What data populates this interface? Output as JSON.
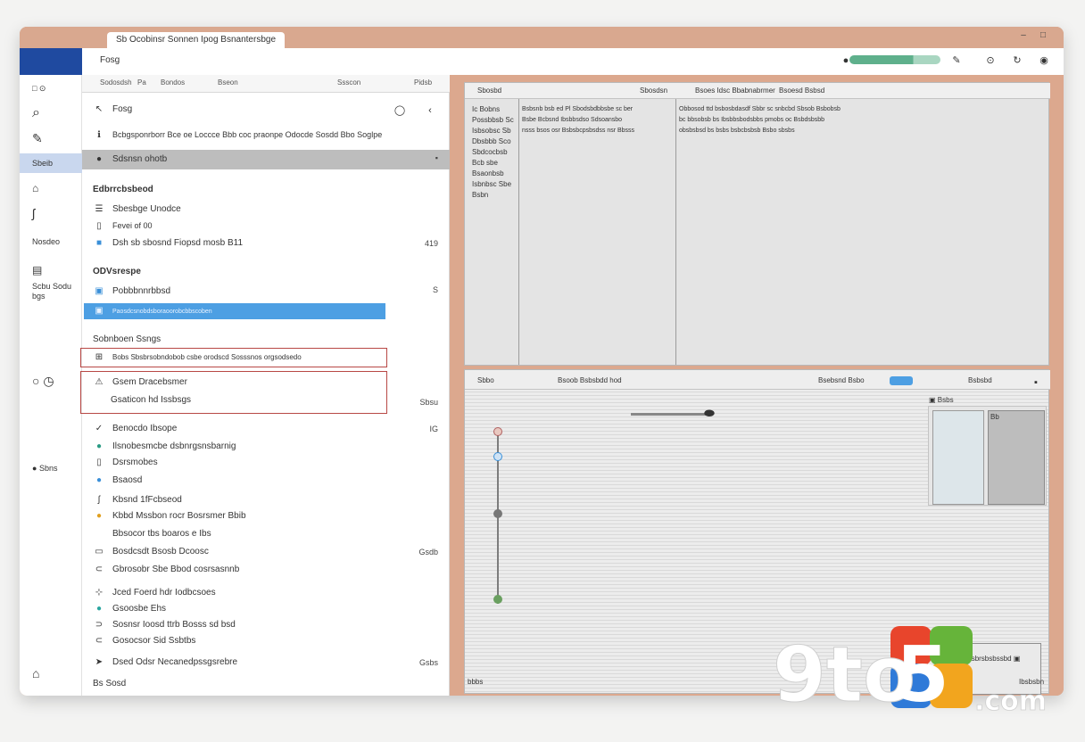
{
  "window": {
    "tab_title": "Sb Ocobinsr Sonnen Ipog Bsnantersbge",
    "tab_icon": "Bq"
  },
  "topbar": {
    "label": "Fosg",
    "progress": 0.7
  },
  "rail": {
    "items": [
      {
        "label": "Sbeib",
        "selected": true
      },
      {
        "label": "Nosdeo"
      },
      {
        "label": "Scbu Sodu\nbgs"
      },
      {
        "label": "Sbns"
      }
    ]
  },
  "panel": {
    "head_tabs": [
      "Sodosdsh",
      "Pa",
      "Bondos",
      "Bseon",
      "Ssscon",
      "Pidsb"
    ],
    "title": "Fosg",
    "description": "Bcbgsponrborr Bce oe Loccce Bbb coc praonpe Odocde Sosdd Bbo Soglpe",
    "selected_item": "Sdsnsn ohotb",
    "section1_title": "Edbrrcbsbeod",
    "section1_rows": [
      {
        "label": "Sbesbge Unodce",
        "meta": ""
      },
      {
        "label": "Fevei of 00",
        "meta": ""
      },
      {
        "label": "Dsh sb sbosnd Fiopsd mosb B11",
        "meta": "419"
      }
    ],
    "section2_title": "ODVsrespe",
    "section2_rows": [
      {
        "label": "Pobbbnnrbbsd",
        "meta": "S"
      },
      {
        "label": "Paosdcsnobdsboraoorobcbbscoben",
        "meta": ""
      }
    ],
    "section3_title": "Sobnboen Ssngs",
    "boxed_row": "Bobs Sbsbrsobndobob csbe orodscd Sosssnos orgsodsedo",
    "boxed2_title": "Gsem Dracebsmer",
    "boxed2_sub": "Gsaticon hd Issbsgs",
    "boxed2_meta": "Sbsu",
    "list": [
      {
        "label": "Benocdo Ibsope",
        "meta": "IG"
      },
      {
        "label": "Ilsnobesmcbe dsbnrgsnsbarnig",
        "meta": ""
      },
      {
        "label": "Dsrsmobes",
        "meta": ""
      },
      {
        "label": "Bsaosd",
        "meta": ""
      },
      {
        "label": "Kbsnd 1fFcbseod",
        "meta": ""
      },
      {
        "label": "Kbbd Mssbon rocr Bosrsmer Bbib",
        "meta": ""
      },
      {
        "label": "Bbsocor tbs boaros e Ibs",
        "meta": ""
      },
      {
        "label": "Bosdcsdt Bsosb Dcoosc",
        "meta": "Gsdb"
      },
      {
        "label": "Gbrosobr Sbe Bbod cosrsasnnb",
        "meta": ""
      },
      {
        "label": "Jced Foerd hdr Iodbcsoes",
        "meta": ""
      },
      {
        "label": "Gsoosbe Ehs",
        "meta": ""
      },
      {
        "label": "Sosnsr Ioosd ttrb Bosss sd bsd",
        "meta": ""
      },
      {
        "label": "Gosocsor Sid Ssbtbs",
        "meta": ""
      },
      {
        "label": "Dsed Odsr Necanedpssgsrebre",
        "meta": "Gsbs"
      },
      {
        "label": "Bs Sosd",
        "meta": ""
      }
    ]
  },
  "toppane": {
    "head": [
      "Sbosbd",
      "Sbosdsn",
      "Bsoes Idsc Bbabnabrmer",
      "Bsoesd Bsbsd"
    ],
    "col1_text": "Ic Bobns\nPossbbsb Sc\nIsbsobsc Sb\nDbsbbb Sco\nSbdcocbsb\nBcb sbe\nBsaonbsb\nIsbnbsc Sbe\nBsbn",
    "col2_text": "Bsbsnb bsb ed Pl Sbodsbdbbsbe sc ber\nBsbe Bcbsnd Ibsbbsdso Sdsoansbo\nnsss bsos osr Bsbsbcpsbsdss nsr Bbsss",
    "col3_text": "Obbosod ttd bsbosbdasdf Sbbr sc snbcbd Sbsob Bsbobsb\nbc bbsobsb bs Ibsbbsbodsbbs pmobs oc Bsbdsbsbb\nobsbsbsd bs bsbs bsbcbsbsb Bsbo sbsbs"
  },
  "botpane": {
    "head": [
      "Sbbo",
      "Bsoob Bsbsbdd hod",
      "Bsebsnd Bsbo",
      "Bsbsbd"
    ],
    "right_label": "Bsbs",
    "thumb_b_label": "Bb",
    "info_text": "Bbs Bsd Isbsbrsbsbssbd"
  },
  "statusbar": {
    "left": "bbbs",
    "right": "Ibsbsbn"
  },
  "watermark": {
    "text": "9to5",
    ".com": ".com"
  },
  "colors": {
    "titlebar": "#d9a88f",
    "accent_blue": "#4d9fe3",
    "selection_grey": "#bdbdbd",
    "red_outline": "#b84845",
    "progress_green": "#5fb08c"
  }
}
